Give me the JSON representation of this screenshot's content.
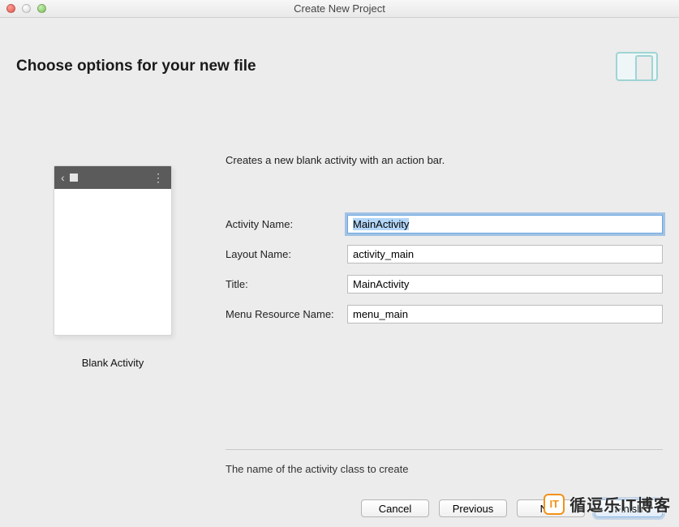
{
  "window": {
    "title": "Create New Project"
  },
  "header": {
    "title": "Choose options for your new file"
  },
  "left": {
    "thumb_label": "Blank Activity"
  },
  "main": {
    "description": "Creates a new blank activity with an action bar.",
    "fields": {
      "activity_name": {
        "label": "Activity Name:",
        "value": "MainActivity"
      },
      "layout_name": {
        "label": "Layout Name:",
        "value": "activity_main"
      },
      "title": {
        "label": "Title:",
        "value": "MainActivity"
      },
      "menu_resource_name": {
        "label": "Menu Resource Name:",
        "value": "menu_main"
      }
    },
    "hint": "The name of the activity class to create"
  },
  "buttons": {
    "cancel": "Cancel",
    "previous": "Previous",
    "next": "Next",
    "finish": "Finish"
  },
  "watermark": {
    "badge": "IT",
    "text": "循逗乐IT博客"
  }
}
